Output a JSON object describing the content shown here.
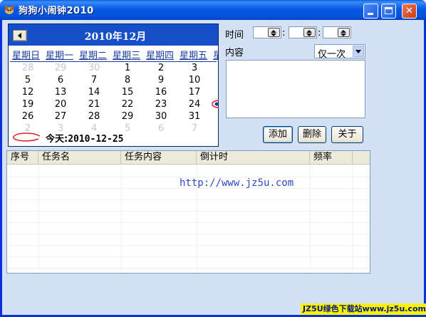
{
  "window": {
    "title": "狗狗小闹钟2010",
    "app_icon": "dog-icon"
  },
  "calendar": {
    "month_title": "2010年12月",
    "prev_button_icon": "left-triangle-icon",
    "weekdays": [
      "星期日",
      "星期一",
      "星期二",
      "星期三",
      "星期四",
      "星期五",
      "星"
    ],
    "weeks": [
      [
        {
          "d": "28",
          "o": true
        },
        {
          "d": "29",
          "o": true
        },
        {
          "d": "30",
          "o": true
        },
        {
          "d": "1"
        },
        {
          "d": "2"
        },
        {
          "d": "3"
        }
      ],
      [
        {
          "d": "5"
        },
        {
          "d": "6"
        },
        {
          "d": "7"
        },
        {
          "d": "8"
        },
        {
          "d": "9"
        },
        {
          "d": "10"
        }
      ],
      [
        {
          "d": "12"
        },
        {
          "d": "13"
        },
        {
          "d": "14"
        },
        {
          "d": "15"
        },
        {
          "d": "16"
        },
        {
          "d": "17"
        }
      ],
      [
        {
          "d": "19"
        },
        {
          "d": "20"
        },
        {
          "d": "21"
        },
        {
          "d": "22"
        },
        {
          "d": "23"
        },
        {
          "d": "24"
        }
      ],
      [
        {
          "d": "26"
        },
        {
          "d": "27"
        },
        {
          "d": "28"
        },
        {
          "d": "29"
        },
        {
          "d": "30"
        },
        {
          "d": "31"
        }
      ],
      [
        {
          "d": "2",
          "o": true
        },
        {
          "d": "3",
          "o": true
        },
        {
          "d": "4",
          "o": true
        },
        {
          "d": "5",
          "o": true
        },
        {
          "d": "6",
          "o": true
        },
        {
          "d": "7",
          "o": true
        }
      ]
    ],
    "today_label": "今天:",
    "today_value": "2010-12-25",
    "accent_color": "#1650c8",
    "today_marker_color": "#e02020"
  },
  "reminder": {
    "time_label": "时间",
    "time_separator": ":",
    "content_label": "内容",
    "frequency_selected": "仅一次"
  },
  "buttons": {
    "add": "添加",
    "delete": "删除",
    "close": "关于"
  },
  "task_list": {
    "columns": [
      "序号",
      "任务名",
      "任务内容",
      "倒计时",
      "频率"
    ],
    "rows": [],
    "overlay_url": "http://www.jz5u.com"
  },
  "watermark": {
    "text": "JZ5U绿色下载站www.jz5u.com"
  }
}
